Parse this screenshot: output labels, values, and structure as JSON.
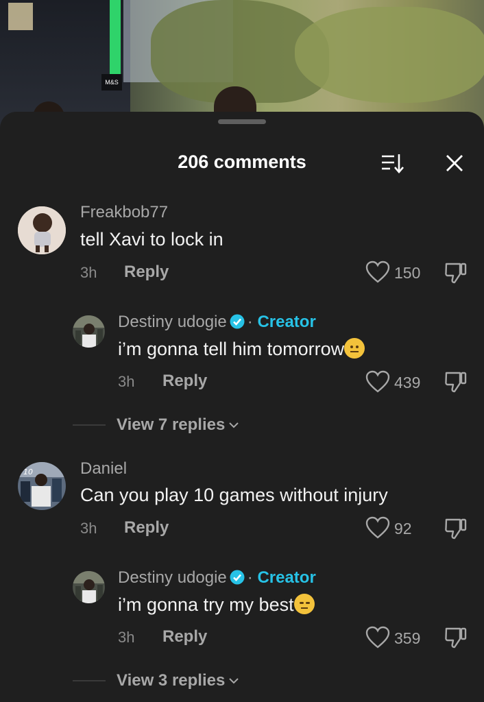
{
  "header": {
    "title": "206 comments"
  },
  "comments": [
    {
      "user": "Freakbob77",
      "text": "tell Xavi to lock in",
      "time": "3h",
      "reply_label": "Reply",
      "likes": "150",
      "reply": {
        "user": "Destiny udogie",
        "dot": "·",
        "creator_label": "Creator",
        "text": "i’m gonna tell him tomorrow",
        "time": "3h",
        "reply_label": "Reply",
        "likes": "439"
      },
      "view_replies": "View 7 replies"
    },
    {
      "user": "Daniel",
      "text": "Can you play 10 games without injury",
      "time": "3h",
      "reply_label": "Reply",
      "likes": "92",
      "reply": {
        "user": "Destiny udogie",
        "dot": "·",
        "creator_label": "Creator",
        "text": "i’m gonna try my best",
        "time": "3h",
        "reply_label": "Reply",
        "likes": "359"
      },
      "view_replies": "View 3 replies"
    }
  ],
  "photo_sign": "M&S",
  "colors": {
    "creator": "#27c2e6",
    "sheet_bg": "#1f1f1f",
    "verified": "#27c2e6"
  }
}
